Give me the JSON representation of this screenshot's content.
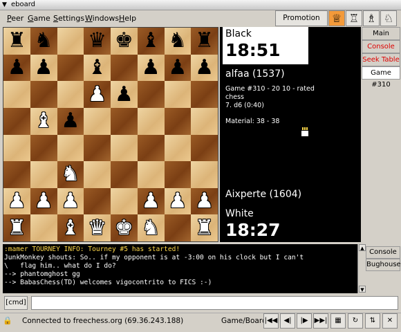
{
  "window": {
    "title": "eboard"
  },
  "menu": [
    {
      "first": "P",
      "rest": "eer"
    },
    {
      "first": "G",
      "rest": "ame"
    },
    {
      "first": "S",
      "rest": "ettings"
    },
    {
      "first": "W",
      "rest": "indows"
    },
    {
      "first": "H",
      "rest": "elp"
    }
  ],
  "promotion": {
    "label": "Promotion Piece",
    "pieces": [
      "♕",
      "♖",
      "♗",
      "♘"
    ]
  },
  "board": {
    "ranks": [
      [
        "bR",
        "bN",
        "",
        "bQ",
        "bK",
        "bB",
        "bN",
        "bR"
      ],
      [
        "bP",
        "bP",
        "",
        "bB",
        "",
        "bP",
        "bP",
        "bP"
      ],
      [
        "",
        "",
        "",
        "wP",
        "bP",
        "",
        "",
        ""
      ],
      [
        "",
        "wB",
        "bP",
        "",
        "",
        "",
        "",
        ""
      ],
      [
        "",
        "",
        "",
        "",
        "",
        "",
        "",
        ""
      ],
      [
        "",
        "",
        "wN",
        "",
        "",
        "",
        "",
        ""
      ],
      [
        "wP",
        "wP",
        "wP",
        "",
        "",
        "wP",
        "wP",
        "wP"
      ],
      [
        "wR",
        "",
        "wB",
        "wQ",
        "wK",
        "wN",
        "",
        "wR"
      ]
    ]
  },
  "info": {
    "black_label": "Black",
    "black_clock": "18:51",
    "black_player": "alfaa (1537)",
    "game_line": "Game #310 - 20 10 - rated chess",
    "move_line": "7. d6 (0:40)",
    "material": "Material: 38 - 38",
    "white_player": "Aixperte (1604)",
    "white_label": "White",
    "white_clock": "18:27"
  },
  "tabs": [
    {
      "label": "Main Board",
      "color": "normal"
    },
    {
      "label": "Console",
      "color": "red"
    },
    {
      "label": "Seek Table",
      "color": "red"
    },
    {
      "label": "Game #310",
      "color": "selected"
    }
  ],
  "console": {
    "lines": [
      {
        "text": ":mamer TOURNEY INFO: Tourney #5 has started!",
        "color": "yellow"
      },
      {
        "text": "JunkMonkey shouts: So.. if my opponent is at -3:00 on his clock but I can't",
        "color": "white"
      },
      {
        "text": "\\   flag him.. what do I do?",
        "color": "white"
      },
      {
        "text": "--> phantomghost gg",
        "color": "white"
      },
      {
        "text": "--> BabasChess(TD) welcomes vigocontrito to FICS :-)",
        "color": "white"
      }
    ],
    "tabs": [
      "Console",
      "Bughouse"
    ]
  },
  "command": {
    "label": "[cmd]",
    "value": ""
  },
  "status": {
    "text": "Connected to freechess.org (69.36.243.188)",
    "game_board_label": "Game/Board:"
  },
  "colors": {
    "light_square": "#dcb478",
    "dark_square": "#7b3f14",
    "red_tab": "#d00000"
  },
  "icons": [
    "lock-icon",
    "first-move-icon",
    "prev-move-icon",
    "next-move-icon",
    "last-move-icon",
    "board-icon",
    "refresh-icon",
    "flip-icon",
    "close-icon"
  ]
}
